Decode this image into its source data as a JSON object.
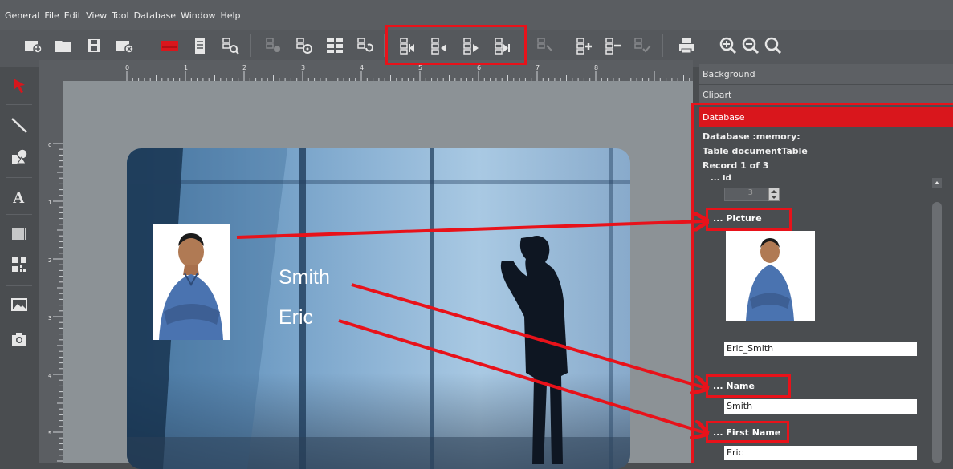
{
  "menu": [
    "General",
    "File",
    "Edit",
    "View",
    "Tool",
    "Database",
    "Window",
    "Help"
  ],
  "toolbar_icons": [
    "new-document-icon",
    "open-folder-icon",
    "save-icon",
    "close-document-icon",
    "card-red-icon",
    "page-icon",
    "preview-icon",
    "db-icon",
    "db-settings-icon",
    "db-grid-icon",
    "db-refresh-icon",
    "db-first-icon",
    "db-prev-icon",
    "db-next-icon",
    "db-last-icon",
    "db-disabled-icon",
    "db-add-icon",
    "db-remove-icon",
    "db-check-icon",
    "print-icon",
    "zoom-in-icon",
    "zoom-out-icon",
    "zoom-fit-icon"
  ],
  "tools": [
    "select-arrow-icon",
    "line-icon",
    "shapes-icon",
    "text-icon",
    "barcode-icon",
    "qrcode-icon",
    "image-icon",
    "camera-icon"
  ],
  "ruler_numbers": [
    "0",
    "1",
    "2",
    "3",
    "4",
    "5",
    "6",
    "7",
    "8"
  ],
  "ruler_left_numbers": [
    "0",
    "1",
    "2",
    "3",
    "4",
    "5"
  ],
  "card": {
    "surname": "Smith",
    "firstname": "Eric"
  },
  "panel": {
    "background": "Background",
    "clipart": "Clipart",
    "database": "Database",
    "db_info": "Database :memory:",
    "table_info": "Table documentTable",
    "record_info": "Record 1 of 3",
    "id_label": "... Id",
    "id_value": "3",
    "picture_label": "... Picture",
    "picture_value": "Eric_Smith",
    "name_label": "... Name",
    "name_value": "Smith",
    "firstname_label": "... First Name",
    "firstname_value": "Eric"
  },
  "colors": {
    "highlight": "#e8121a",
    "panel_active": "#d9161c"
  }
}
